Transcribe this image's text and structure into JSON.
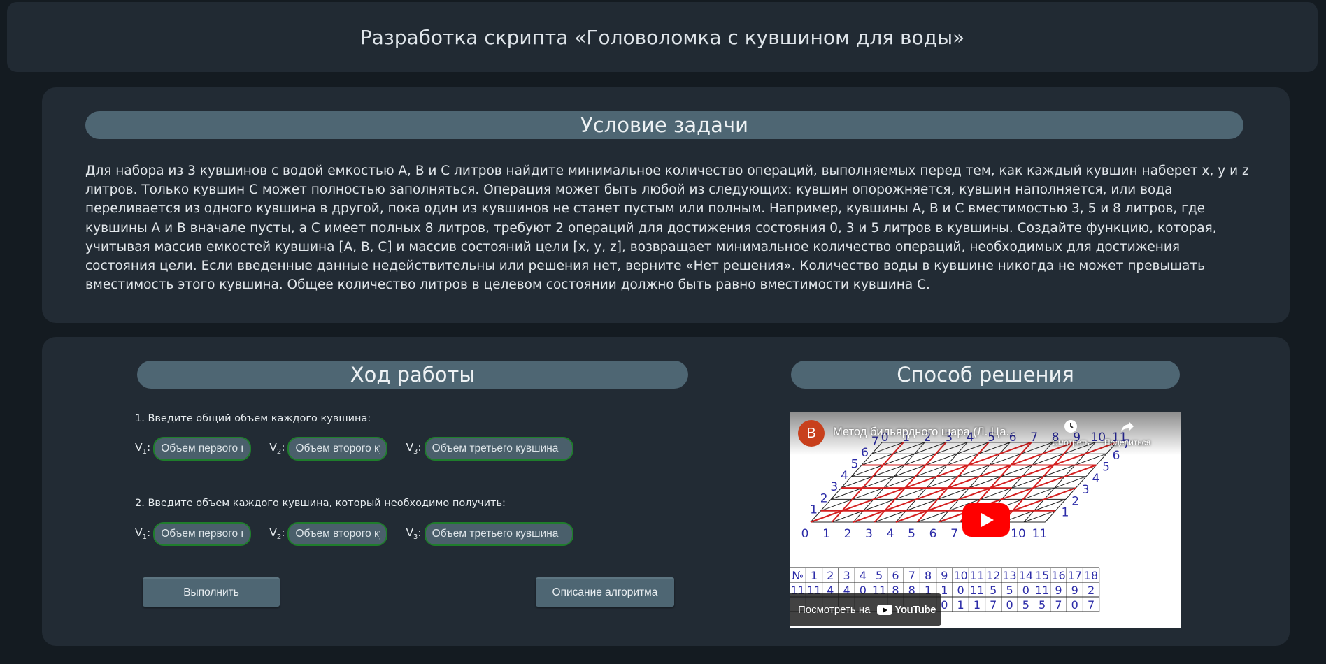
{
  "header": {
    "title": "Разработка скрипта «Головоломка с кувшином для воды»"
  },
  "task": {
    "title": "Условие задачи",
    "text": "Для набора из 3 кувшинов с водой емкостью A, B и C литров найдите минимальное количество операций, выполняемых перед тем, как каждый кувшин наберет x, y и z литров. Только кувшин C может полностью заполняться. Операция может быть любой из следующих: кувшин опорожняется, кувшин наполняется, или вода переливается из одного кувшина в другой, пока один из кувшинов не станет пустым или полным. Например, кувшины A, B и C вместимостью 3, 5 и 8 литров, где кувшины A и B вначале пусты, а C имеет полных 8 литров, требуют 2 операций для достижения состояния 0, 3 и 5 литров в кувшины. Создайте функцию, которая, учитывая массив емкостей кувшина [A, B, C] и массив состояний цели [x, y, z], возвращает минимальное количество операций, необходимых для достижения состояния цели. Если введенные данные недействительны или решения нет, верните «Нет решения». Количество воды в кувшине никогда не может превышать вместимость этого кувшина. Общее количество литров в целевом состоянии должно быть равно вместимости кувшина C."
  },
  "work": {
    "title": "Ход работы",
    "step1_label": "1. Введите общий объем каждого кувшина:",
    "step2_label": "2. Введите объем каждого кувшина, который необходимо получить:",
    "v_letter": "V",
    "v1_sub": "1",
    "v2_sub": "2",
    "v3_sub": "3",
    "colon": ":",
    "placeholders": {
      "first": "Объем первого кувшина",
      "second": "Объем второго кувшина",
      "third": "Объем третьего кувшина"
    },
    "run_button": "Выполнить",
    "describe_button": "Описание алгоритма",
    "input_border_color": "#1f7d2c"
  },
  "solution": {
    "title": "Способ решения",
    "video": {
      "channel_initial": "В",
      "title": "Метод бильярдного шара (Л. Ца...",
      "watch_later": "Смотреть",
      "share": "Поделиться",
      "watch_on": "Посмотреть на",
      "youtube": "YouTube",
      "bottom_axis": [
        "0",
        "1",
        "2",
        "3",
        "4",
        "5",
        "6",
        "7",
        "8",
        "9",
        "10",
        "11"
      ],
      "top_axis": [
        "0",
        "1",
        "2",
        "3",
        "4",
        "5",
        "6",
        "7",
        "8",
        "9",
        "10",
        "11"
      ],
      "left_axis": [
        "1",
        "2",
        "3",
        "4",
        "5",
        "6",
        "7"
      ],
      "right_axis": [
        "1",
        "2",
        "3",
        "4",
        "5",
        "6",
        "7"
      ],
      "table": {
        "header": [
          "№",
          "1",
          "2",
          "3",
          "4",
          "5",
          "6",
          "7",
          "8",
          "9",
          "10",
          "11",
          "12",
          "13",
          "14",
          "15",
          "16",
          "17",
          "18"
        ],
        "row1": [
          "11",
          "11",
          "4",
          "4",
          "0",
          "11",
          "8",
          "8",
          "1",
          "1",
          "0",
          "11",
          "5",
          "5",
          "0",
          "11",
          "9",
          "9",
          "2"
        ],
        "row2": [
          "",
          "",
          "",
          "",
          "",
          "",
          "",
          "",
          "",
          "",
          "0",
          "1",
          "1",
          "7",
          "0",
          "5",
          "5",
          "7",
          "0",
          "7"
        ]
      }
    }
  }
}
